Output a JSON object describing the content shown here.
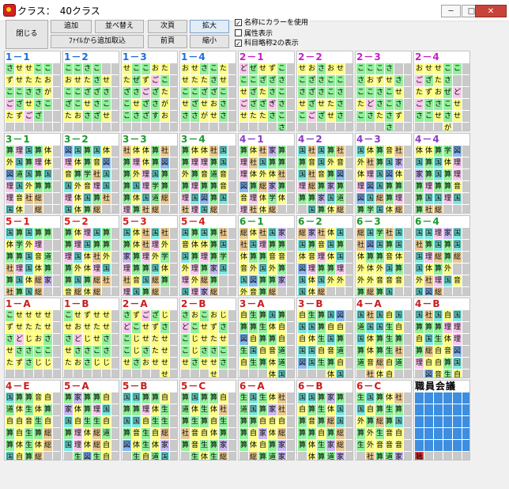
{
  "window": {
    "title": "クラス：　40クラス",
    "min_label": "─",
    "max_label": "□",
    "close_label": "✕"
  },
  "toolbar": {
    "close_label": "閉じる",
    "add_label": "追加",
    "sort_label": "並べ替え",
    "import_label": "ﾌｧｲﾙから追加取込",
    "next_page_label": "次頁",
    "prev_page_label": "前頁",
    "zoom_in_label": "拡大",
    "zoom_out_label": "縮小"
  },
  "options": [
    {
      "label": "名称にカラーを使用",
      "checked": true
    },
    {
      "label": "属性表示",
      "checked": false
    },
    {
      "label": "科目略称2の表示",
      "checked": true
    }
  ],
  "palette": {
    "green": "#92f09a",
    "yellow": "#fcfc86",
    "pink": "#f8c8ec",
    "blue": "#88b8f0",
    "cyan": "#7ee8e0",
    "lilac": "#c8b8f0",
    "tan": "#e8c890",
    "gray": "#c9c9c9",
    "staff": "#3d8ee0",
    "red": "#e84040"
  },
  "classes": [
    {
      "name": "1－1",
      "color": "#1a6fdc",
      "rows": [
        "させせここ",
        "ずせたたお",
        "ここささが",
        "ござせさこ",
        "たずござ",
        "　　　　　"
      ]
    },
    {
      "name": "1－2",
      "color": "#1a6fdc",
      "rows": [
        "ここさこ",
        "おせたさせ",
        "ここざざさ",
        "ざこせさこ",
        "たおさざせ",
        "　　　　　"
      ]
    },
    {
      "name": "1－3",
      "color": "#1a6fdc",
      "rows": [
        "せここおた",
        "たぜずごこ",
        "ざさござた",
        "こせざさが",
        "こさざすお",
        "　　　　　"
      ]
    },
    {
      "name": "1－4",
      "color": "#1a6fdc",
      "rows": [
        "おせさこた",
        "せたたさせ",
        "ここざざこ",
        "せざせおさ",
        "ささがせさ",
        "　　　　　"
      ]
    },
    {
      "name": "2－1",
      "color": "#c81ec8",
      "rows": [
        "どぜせずこ",
        "ここざざさ",
        "せざたさこ",
        "ござざぎさ",
        "せたたさこ",
        "　　　　さ"
      ]
    },
    {
      "name": "2－2",
      "color": "#c81ec8",
      "rows": [
        "せおさおせ",
        "こざさここ",
        "さざさこさ",
        "せざせたさ",
        "こござせさ",
        "　　　　　"
      ]
    },
    {
      "name": "2－3",
      "color": "#c81ec8",
      "rows": [
        "こここさ",
        "さおずせさ",
        "ここさこせ",
        "たどさこさ",
        "こさたさず",
        "　　　さ　"
      ]
    },
    {
      "name": "2－4",
      "color": "#c81ec8",
      "rows": [
        "おせせここ",
        "ござたさ",
        "たずおぜど",
        "ござさこせ",
        "さこせさせ",
        "　　　が　"
      ]
    },
    {
      "name": "3－1",
      "color": "#1a9a2a",
      "rows": [
        "算理国算体",
        "外国算理体",
        "図道国算国",
        "理国外算算",
        "理音社総",
        "国体　総"
      ]
    },
    {
      "name": "3－2",
      "color": "#1a9a2a",
      "rows": [
        "図国算国体",
        "理体算音図",
        "音算学社国",
        "国外音理国",
        "理体国算社",
        "国体算総"
      ]
    },
    {
      "name": "3－3",
      "color": "#1a9a2a",
      "rows": [
        "社体体算社",
        "算理体算図",
        "算外理国算",
        "算国理学算",
        "算体国道総",
        "理算社総"
      ]
    },
    {
      "name": "3－4",
      "color": "#1a9a2a",
      "rows": [
        "算体体社国",
        "算理理算国",
        "外算音道音",
        "算理算算音",
        "理国図算国",
        "社理国総"
      ]
    },
    {
      "name": "4－1",
      "color": "#8a3ac8",
      "rows": [
        "算体社家算",
        "理社国算算",
        "理体外体社",
        "図算総家算",
        "音理体学体",
        "理社体総"
      ]
    },
    {
      "name": "4－2",
      "color": "#8a3ac8",
      "rows": [
        "国社国算社",
        "算音国外音",
        "国社音算図",
        "理総算家算",
        "算算家国道",
        "　国算体総"
      ]
    },
    {
      "name": "4－3",
      "color": "#8a3ac8",
      "rows": [
        "国体算音社",
        "外社算国家",
        "体理国図体",
        "理図国算算",
        "図国総算理",
        "算学国体総"
      ]
    },
    {
      "name": "4－4",
      "color": "#8a3ac8",
      "rows": [
        "体体算学図",
        "国算国体理",
        "家算国算理",
        "算理算算音",
        "算国国理国",
        "算社総"
      ]
    },
    {
      "name": "5－1",
      "color": "#d81e1e",
      "rows": [
        "国算国算算",
        "体学外理",
        "算算国音道",
        "社理国体算",
        "算国体総家",
        "社算国総"
      ]
    },
    {
      "name": "5－2",
      "color": "#d81e1e",
      "rows": [
        "算体理国算",
        "算理国算算",
        "理国体社外",
        "算外体理国",
        "算国算総社",
        "音総体総"
      ]
    },
    {
      "name": "5－3",
      "color": "#d81e1e",
      "rows": [
        "国体社国社",
        "算体社理外",
        "家算理外学",
        "理算算国体",
        "社音国総算",
        "理国算総"
      ]
    },
    {
      "name": "5－4",
      "color": "#d81e1e",
      "rows": [
        "国算国算社",
        "音体体算国",
        "国算理算学",
        "外理算家国",
        "理外総算",
        "国理家総"
      ]
    },
    {
      "name": "6－1",
      "color": "#1a9a2a",
      "rows": [
        "総体社国家",
        "社国理算算",
        "体算算音音",
        "音外国外算",
        "国図算算家",
        "外音算総"
      ]
    },
    {
      "name": "6－2",
      "color": "#1a9a2a",
      "rows": [
        "総家社体国",
        "国算音国算",
        "体音理体国",
        "図理算算理",
        "国体国外外",
        "国体総"
      ]
    },
    {
      "name": "6－3",
      "color": "#1a9a2a",
      "rows": [
        "総国学社国",
        "社図国算国",
        "体算算音体",
        "外体外国算",
        "外外音音音",
        "算総算国"
      ]
    },
    {
      "name": "6－4",
      "color": "#1a9a2a",
      "rows": [
        "国国理家国",
        "社算国算国",
        "国理総算総",
        "国体算外",
        "外社理国音",
        "国図総"
      ]
    },
    {
      "name": "1－A",
      "color": "#c81e1e",
      "rows": [
        "こせせせせ",
        "ずせたたせ",
        "さどじおさ",
        "せささここ",
        "たずさじじ",
        "　　　　　"
      ]
    },
    {
      "name": "1－B",
      "color": "#c81e1e",
      "rows": [
        "こせずせせ",
        "せおせたせ",
        "さどじせさ",
        "せささこさ",
        "たおさじじ",
        "　　　　　"
      ]
    },
    {
      "name": "2－A",
      "color": "#c81e1e",
      "rows": [
        "さずござじ",
        "どこせずさ",
        "こじせたせ",
        "こじさたせ",
        "せさおせせ",
        "　　　　せ"
      ]
    },
    {
      "name": "2－B",
      "color": "#c81e1e",
      "rows": [
        "さおこおじ",
        "どこせずさ",
        "こじせたせ",
        "こじささこ",
        "せさせせさ",
        "　　　せ　"
      ]
    },
    {
      "name": "3－A",
      "color": "#c81e1e",
      "rows": [
        "自生算国算",
        "算算生体自",
        "図自算算自",
        "生国自音道",
        "自生算体道",
        "　　　体国"
      ]
    },
    {
      "name": "3－B",
      "color": "#c81e1e",
      "rows": [
        "自生算国図",
        "国国算自自",
        "自体生国算",
        "国国自音道",
        "図国生算自",
        "　　　体国"
      ]
    },
    {
      "name": "4－A",
      "color": "#c81e1e",
      "rows": [
        "国社国自国",
        "道国国生自",
        "国体算生算",
        "算体算生社",
        "道音総自道",
        "　社体自"
      ]
    },
    {
      "name": "4－B",
      "color": "#c81e1e",
      "rows": [
        "国社国自国",
        "算算算理理",
        "自国生体理",
        "算総自音図",
        "理自自算国",
        "　図音生自"
      ]
    },
    {
      "name": "4－E",
      "color": "#c81e1e",
      "rows": [
        "国算算音自",
        "道体生体算",
        "自自音生自",
        "算自生算総",
        "算体生体総",
        "国自算総"
      ]
    },
    {
      "name": "5－A",
      "color": "#c81e1e",
      "rows": [
        "算家算算自",
        "家体算理国",
        "国自生生自",
        "算理体総道",
        "国理体総自",
        "　生図生自"
      ]
    },
    {
      "name": "5－B",
      "color": "#c81e1e",
      "rows": [
        "国国算算自",
        "算算理体生",
        "国国自生生",
        "算音生自総",
        "図体生体家",
        "　生自道国"
      ]
    },
    {
      "name": "5－C",
      "color": "#c81e1e",
      "rows": [
        "算国算算自",
        "道体生体社",
        "算生算自生",
        "社音自体算",
        "算音生算家",
        "　生体生総"
      ]
    },
    {
      "name": "6－A",
      "color": "#c81e1e",
      "rows": [
        "生国生体社",
        "道国算家社",
        "算算自自自",
        "算自家体総",
        "算体自算家",
        "　総算道家"
      ]
    },
    {
      "name": "6－B",
      "color": "#c81e1e",
      "rows": [
        "国国算家算",
        "自算生体国",
        "算音算総国",
        "算算自算総",
        "算体生家総",
        "　体算道家"
      ]
    },
    {
      "name": "6－C",
      "color": "#c81e1e",
      "rows": [
        "生国算体社",
        "国自算生算",
        "外算総算国",
        "算外生音自",
        "生外音音音",
        "　社算道家"
      ]
    }
  ],
  "staff_panel": {
    "name": "職員会議",
    "mark": "職"
  }
}
